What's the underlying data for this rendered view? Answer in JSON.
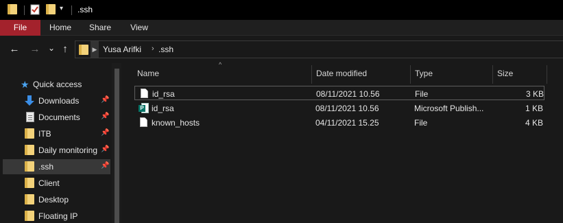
{
  "window": {
    "title": ".ssh",
    "quick_access_toolbar": [
      "folder-icon",
      "properties-icon",
      "new-folder-icon",
      "customize-dropdown-icon"
    ]
  },
  "ribbon": {
    "tabs": [
      "File",
      "Home",
      "Share",
      "View"
    ],
    "accent": "#a3222c"
  },
  "navigation": {
    "back_icon": "←",
    "forward_icon": "→",
    "recent_icon": "⌄",
    "up_icon": "↑"
  },
  "address_bar": {
    "breadcrumbs": [
      "Yusa Arifki",
      ".ssh"
    ],
    "separator": "›"
  },
  "sidebar": {
    "items": [
      {
        "label": "Quick access",
        "icon": "star-icon",
        "pinned": false
      },
      {
        "label": "Downloads",
        "icon": "download-icon",
        "pinned": true
      },
      {
        "label": "Documents",
        "icon": "document-icon",
        "pinned": true
      },
      {
        "label": "ITB",
        "icon": "folder-icon",
        "pinned": true
      },
      {
        "label": "Daily monitoring",
        "icon": "folder-icon",
        "pinned": true
      },
      {
        "label": ".ssh",
        "icon": "folder-icon",
        "pinned": true,
        "selected": true
      },
      {
        "label": "Client",
        "icon": "folder-icon",
        "pinned": false
      },
      {
        "label": "Desktop",
        "icon": "folder-icon",
        "pinned": false
      },
      {
        "label": "Floating IP",
        "icon": "folder-icon",
        "pinned": false
      }
    ],
    "pin_glyph": "📌"
  },
  "file_list": {
    "columns": [
      "Name",
      "Date modified",
      "Type",
      "Size"
    ],
    "sort_glyph": "^",
    "rows": [
      {
        "name": "id_rsa",
        "date": "08/11/2021 10.56",
        "type": "File",
        "size": "3 KB",
        "icon": "file-icon"
      },
      {
        "name": "id_rsa",
        "date": "08/11/2021 10.56",
        "type": "Microsoft Publish...",
        "size": "1 KB",
        "icon": "publisher-icon"
      },
      {
        "name": "known_hosts",
        "date": "04/11/2021 15.25",
        "type": "File",
        "size": "4 KB",
        "icon": "file-icon"
      }
    ]
  },
  "publisher_letter": "P"
}
